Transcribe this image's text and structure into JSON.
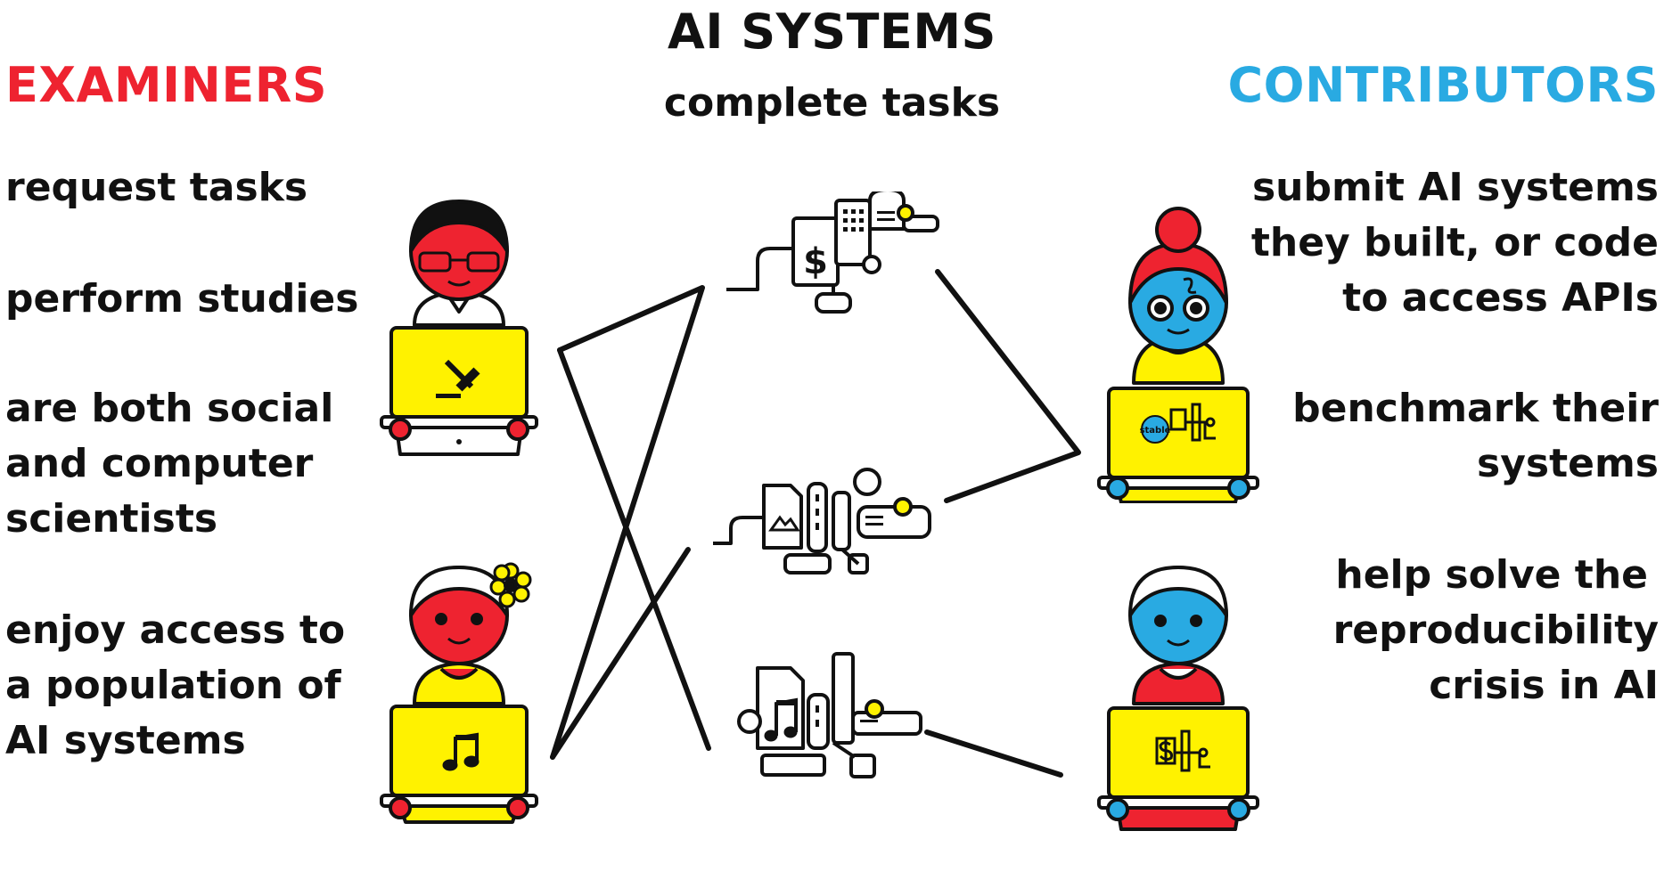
{
  "title": "AI SYSTEMS",
  "subtitle": "complete tasks",
  "examiners": {
    "heading": "EXAMINERS",
    "lines": [
      "request tasks",
      "perform studies",
      "are both social",
      "and computer",
      "scientists",
      "enjoy access to",
      "a population of",
      "AI systems"
    ]
  },
  "contributors": {
    "heading": "CONTRIBUTORS",
    "lines": [
      "submit AI systems",
      "they built, or code",
      "to access APIs",
      "benchmark their",
      "systems",
      "help solve the",
      "reproducibility",
      "crisis in AI"
    ]
  },
  "badge_text": "stable",
  "colors": {
    "examiners": "#ee2330",
    "contributors": "#29aae2",
    "accent_yellow": "#fff200",
    "ink": "#111111"
  },
  "icons": [
    "gavel-icon",
    "music-note-icon",
    "dollar-icon",
    "mountain-image-icon",
    "music-note-icon"
  ]
}
